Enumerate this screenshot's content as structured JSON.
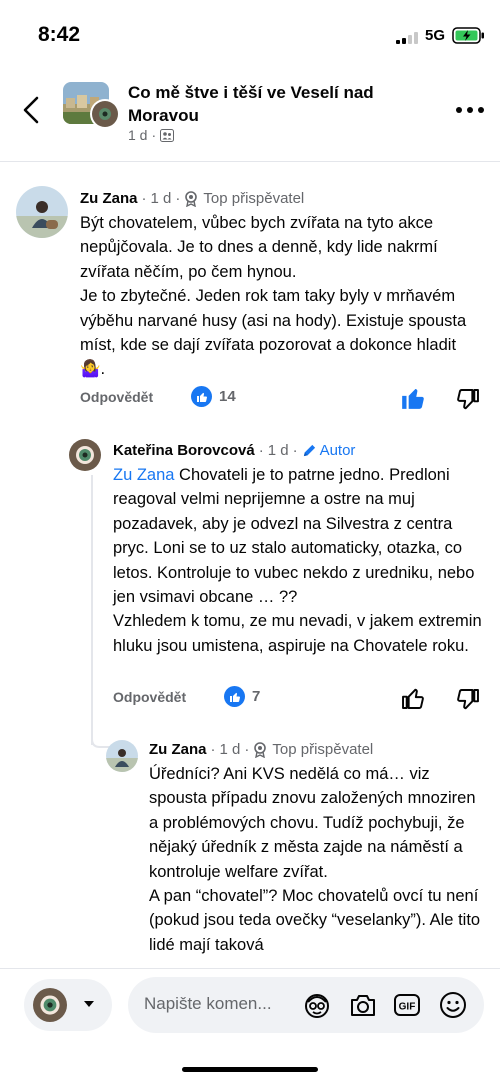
{
  "status": {
    "time": "8:42",
    "network": "5G"
  },
  "header": {
    "title": "Co mě štve i těší ve Veselí nad Moravou",
    "meta_time": "1 d",
    "meta_dot": "·"
  },
  "comments": [
    {
      "author": "Zu Zana",
      "time": "1 d",
      "badge": "Top přispěvatel",
      "text": "Být chovatelem, vůbec bych zvířata na tyto akce nepůjčovala. Je to dnes a denně, kdy lide nakrmí zvířata něčím, po čem hynou.\nJe to zbytečné. Jeden rok tam taky byly v mrňavém výběhu narvané husy (asi na hody). Existuje spousta míst, kde se dají zvířata pozorovat a dokonce hladit 🤷‍♀️.",
      "reply_label": "Odpovědět",
      "likes": "14"
    },
    {
      "author": "Kateřina Borovcová",
      "time": "1 d",
      "badge": "Autor",
      "mention": "Zu Zana",
      "text": " Chovateli je to patrne jedno. Predloni reagoval velmi neprijemne a ostre na muj pozadavek, aby je odvezl na Silvestra z centra pryc. Loni se to uz stalo automaticky, otazka, co letos. Kontroluje to vubec nekdo z uredniku, nebo jen vsimavi obcane … ??\nVzhledem k tomu, ze mu nevadi, v jakem extremin hluku jsou umistena, aspiruje na Chovatele roku.",
      "reply_label": "Odpovědět",
      "likes": "7"
    },
    {
      "author": "Zu Zana",
      "time": "1 d",
      "badge": "Top přispěvatel",
      "text": "Úředníci? Ani KVS nedělá co má… viz spousta případu znovu založených mnoziren a problémových chovu. Tudíž pochybuji, že nějaký úředník z města zajde na náměstí a kontroluje welfare zvířat.\nA pan “chovatel”? Moc chovatelů ovcí tu není (pokud jsou teda ovečky “veselanky”). Ale tito lidé mají taková"
    }
  ],
  "composer": {
    "placeholder": "Napište komen..."
  },
  "colors": {
    "accent": "#1877f2",
    "secondary_text": "#65676b",
    "divider": "#e4e6eb"
  }
}
